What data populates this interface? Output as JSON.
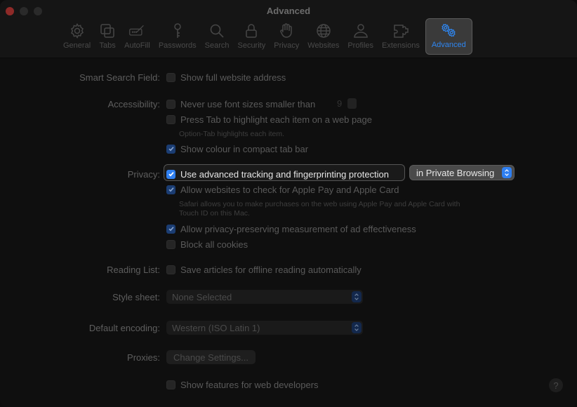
{
  "window": {
    "title": "Advanced"
  },
  "toolbar": {
    "items": [
      {
        "label": "General",
        "icon": "gear-icon"
      },
      {
        "label": "Tabs",
        "icon": "tabs-icon"
      },
      {
        "label": "AutoFill",
        "icon": "autofill-icon"
      },
      {
        "label": "Passwords",
        "icon": "key-icon"
      },
      {
        "label": "Search",
        "icon": "search-icon"
      },
      {
        "label": "Security",
        "icon": "lock-icon"
      },
      {
        "label": "Privacy",
        "icon": "hand-icon"
      },
      {
        "label": "Websites",
        "icon": "globe-icon"
      },
      {
        "label": "Profiles",
        "icon": "person-icon"
      },
      {
        "label": "Extensions",
        "icon": "puzzle-icon"
      },
      {
        "label": "Advanced",
        "icon": "gears-icon",
        "active": true
      }
    ],
    "accent_color": "#2f86f0"
  },
  "settings": {
    "smart_search": {
      "label": "Smart Search Field:",
      "option": "Show full website address",
      "checked": false
    },
    "accessibility": {
      "label": "Accessibility:",
      "font_size_option": "Never use font sizes smaller than",
      "font_size_value": "9",
      "font_size_checked": false,
      "tab_option": "Press Tab to highlight each item on a web page",
      "tab_checked": false,
      "tab_note": "Option-Tab highlights each item.",
      "colour_option": "Show colour in compact tab bar",
      "colour_checked": true
    },
    "privacy": {
      "label": "Privacy:",
      "tracking_option": "Use advanced tracking and fingerprinting protection",
      "tracking_checked": true,
      "tracking_scope": "in Private Browsing",
      "applepay_option": "Allow websites to check for Apple Pay and Apple Card",
      "applepay_checked": true,
      "applepay_note_1": "Safari allows you to make purchases on the web using Apple Pay and Apple Card with",
      "applepay_note_2": "Touch ID on this Mac.",
      "ad_option": "Allow privacy-preserving measurement of ad effectiveness",
      "ad_checked": true,
      "cookies_option": "Block all cookies",
      "cookies_checked": false
    },
    "reading_list": {
      "label": "Reading List:",
      "option": "Save articles for offline reading automatically",
      "checked": false
    },
    "style_sheet": {
      "label": "Style sheet:",
      "value": "None Selected"
    },
    "encoding": {
      "label": "Default encoding:",
      "value": "Western (ISO Latin 1)"
    },
    "proxies": {
      "label": "Proxies:",
      "button": "Change Settings..."
    },
    "developer": {
      "option": "Show features for web developers",
      "checked": false
    },
    "help": {
      "label": "?"
    }
  }
}
